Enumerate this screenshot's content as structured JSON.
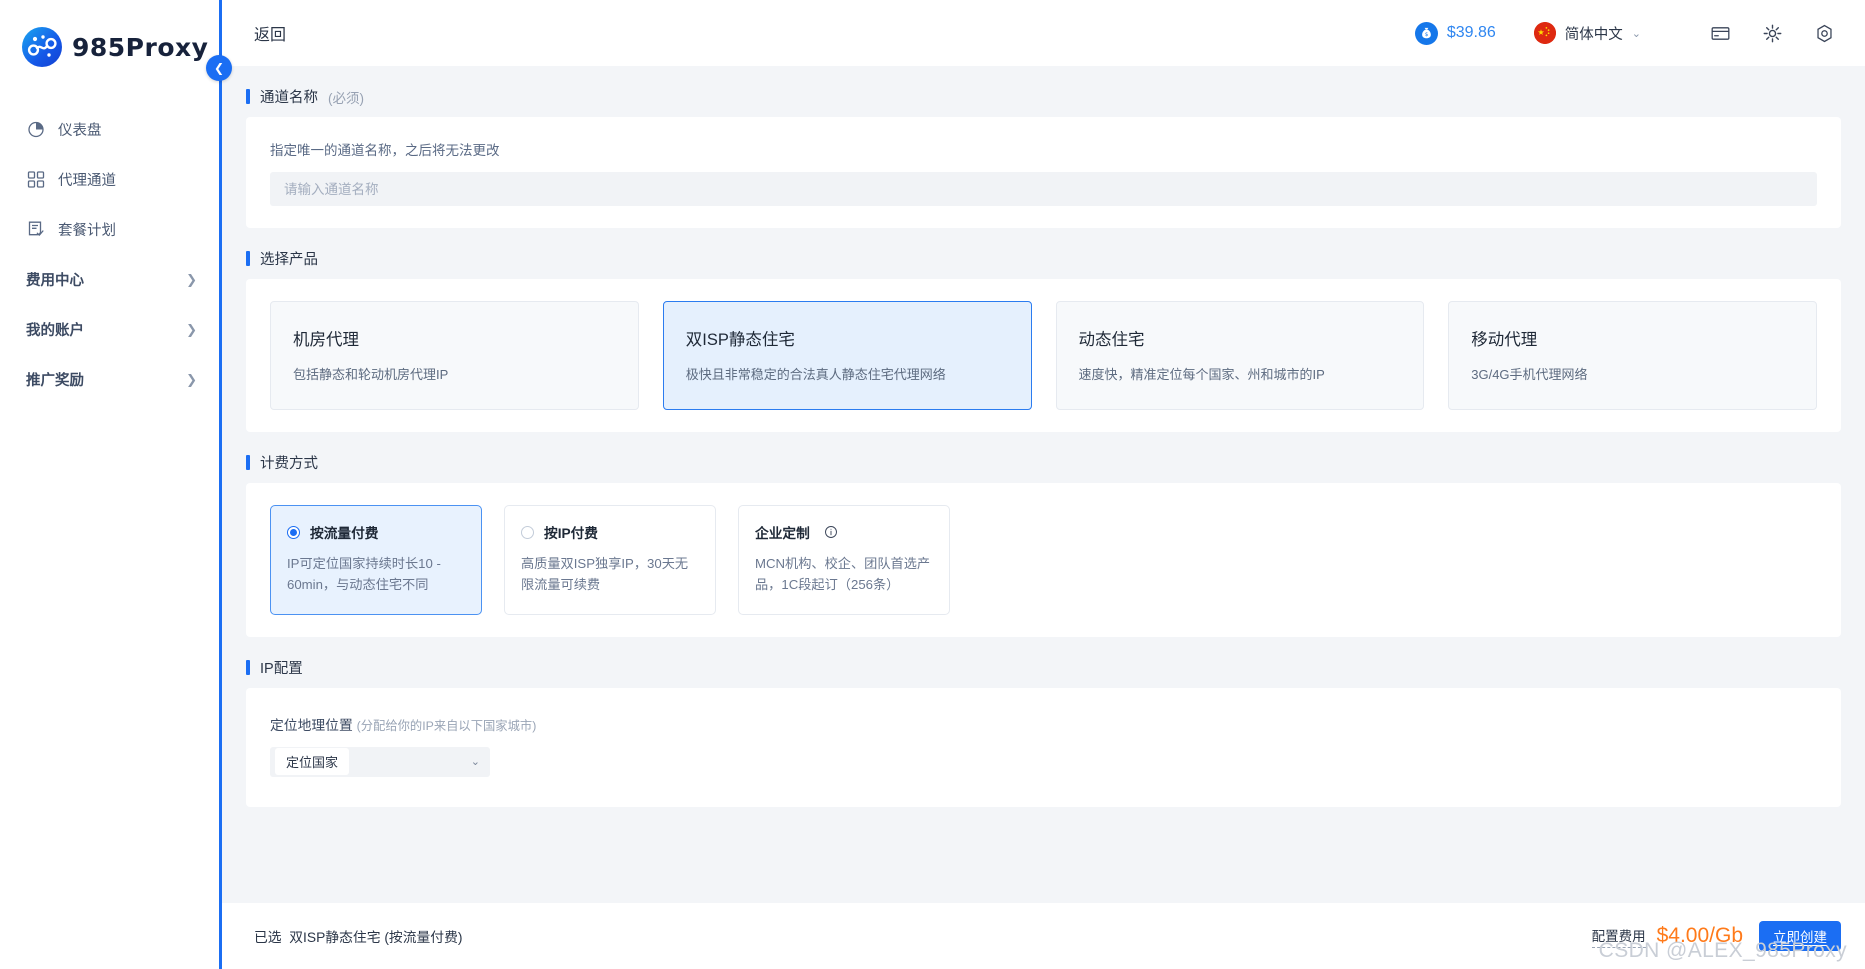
{
  "brand": {
    "name": "985Proxy",
    "logo_icon": "proxy-network-logo-icon"
  },
  "sidebar": {
    "collapse_icon": "collapse-left-icon",
    "items": [
      {
        "label": "仪表盘",
        "icon": "dashboard-pie-icon",
        "has_chevron": false
      },
      {
        "label": "代理通道",
        "icon": "grid-squares-icon",
        "has_chevron": false
      },
      {
        "label": "套餐计划",
        "icon": "plan-checklist-icon",
        "has_chevron": false
      },
      {
        "label": "费用中心",
        "icon": "",
        "has_chevron": true
      },
      {
        "label": "我的账户",
        "icon": "",
        "has_chevron": true
      },
      {
        "label": "推广奖励",
        "icon": "",
        "has_chevron": true
      }
    ]
  },
  "topbar": {
    "back_label": "返回",
    "balance": "$39.86",
    "balance_icon": "money-bag-icon",
    "language": "简体中文",
    "language_flag": "china-flag-icon",
    "language_chevron_icon": "chevron-down-icon",
    "icons": [
      {
        "name": "wallet-card-icon"
      },
      {
        "name": "brightness-sun-icon"
      },
      {
        "name": "settings-hexagon-icon"
      }
    ]
  },
  "sections": {
    "channel_name": {
      "title": "通道名称",
      "subtitle": "(必须)",
      "hint": "指定唯一的通道名称，之后将无法更改",
      "input_value": "",
      "input_placeholder": "请输入通道名称"
    },
    "select_product": {
      "title": "选择产品",
      "products": [
        {
          "title": "机房代理",
          "desc": "包括静态和轮动机房代理IP",
          "selected": false
        },
        {
          "title": "双ISP静态住宅",
          "desc": "极快且非常稳定的合法真人静态住宅代理网络",
          "selected": true
        },
        {
          "title": "动态住宅",
          "desc": "速度快，精准定位每个国家、州和城市的IP",
          "selected": false
        },
        {
          "title": "移动代理",
          "desc": "3G/4G手机代理网络",
          "selected": false
        }
      ]
    },
    "billing": {
      "title": "计费方式",
      "options": [
        {
          "title": "按流量付费",
          "desc": "IP可定位国家持续时长10 - 60min，与动态住宅不同",
          "selected": true,
          "info_icon": false
        },
        {
          "title": "按IP付费",
          "desc": "高质量双ISP独享IP，30天无限流量可续费",
          "selected": false,
          "info_icon": false
        },
        {
          "title": "企业定制",
          "desc": "MCN机构、校企、团队首选产品，1C段起订（256条）",
          "selected": false,
          "info_icon": true
        }
      ]
    },
    "ip_config": {
      "title": "IP配置",
      "geo_label": "定位地理位置",
      "geo_hint": "(分配给你的IP来自以下国家城市)",
      "country_select_value": "定位国家",
      "country_select_chevron_icon": "chevron-down-icon"
    }
  },
  "footer": {
    "selected_prefix": "已选",
    "selected_value": "双ISP静态住宅 (按流量付费)",
    "fee_label": "配置费用",
    "fee_amount": "$4.00/Gb",
    "create_button": "立即创建"
  },
  "watermark": "CSDN @ALEX_985Proxy",
  "colors": {
    "accent": "#1b6ef3",
    "selected_bg": "#e5f0fd",
    "price": "#ff7a1a",
    "balance": "#2f86f0",
    "page_bg": "#f3f5f8"
  }
}
